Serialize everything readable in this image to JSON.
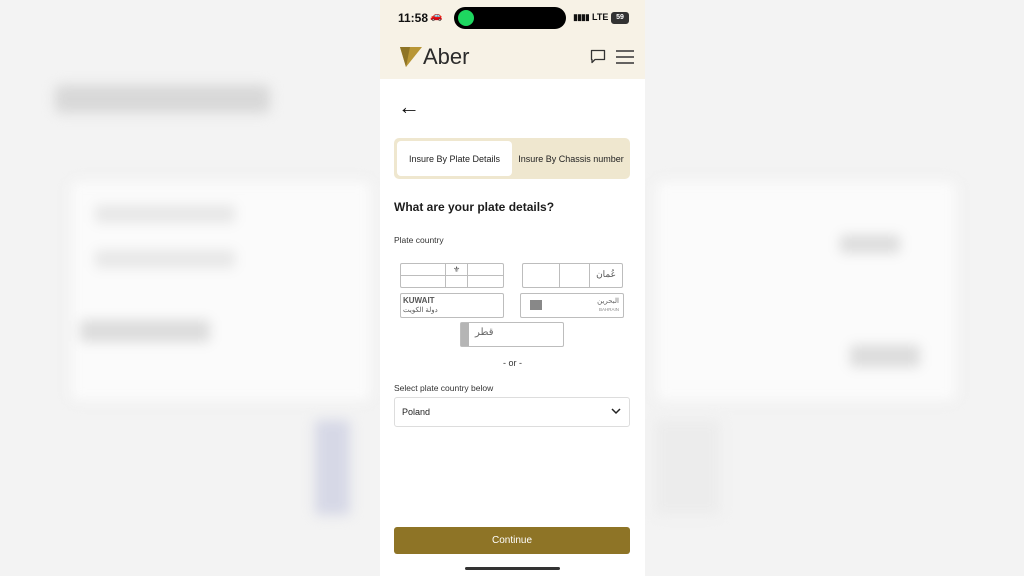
{
  "status_bar": {
    "time": "11:58",
    "network": "LTE",
    "battery": "59"
  },
  "header": {
    "brand": "Aber",
    "icons": [
      "chat-icon",
      "menu-icon"
    ]
  },
  "tabs": [
    {
      "label": "Insure By Plate Details",
      "active": true
    },
    {
      "label": "Insure By Chassis number",
      "active": false
    }
  ],
  "form": {
    "heading": "What are your plate details?",
    "plate_country_label": "Plate country",
    "plates": {
      "kuwait_en": "KUWAIT",
      "kuwait_ar": "دولة الكويت",
      "oman_ar": "عُمان",
      "bahrain_ar": "البحرين",
      "bahrain_en": "BAHRAIN",
      "qatar_ar": "قطر"
    },
    "or_text": "- or -",
    "select_label": "Select plate country below",
    "selected_country": "Poland"
  },
  "continue_button": "Continue",
  "colors": {
    "accent": "#8e7426",
    "header_bg": "#f7f2e6",
    "tab_bg": "#efe7cf"
  }
}
